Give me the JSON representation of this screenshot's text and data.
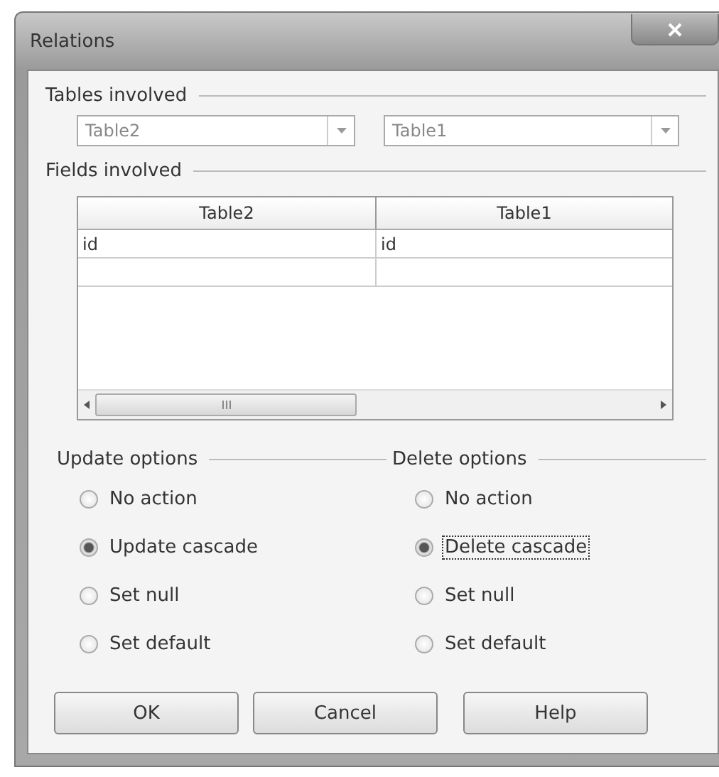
{
  "window": {
    "title": "Relations"
  },
  "tables_involved": {
    "label": "Tables involved",
    "combos": [
      {
        "value": "Table2"
      },
      {
        "value": "Table1"
      }
    ]
  },
  "fields_involved": {
    "label": "Fields involved",
    "columns": [
      "Table2",
      "Table1"
    ],
    "rows": [
      [
        "id",
        "id"
      ],
      [
        "",
        ""
      ]
    ]
  },
  "option_groups": [
    {
      "label": "Update options",
      "options": [
        {
          "label": "No action",
          "selected": false,
          "focused": false
        },
        {
          "label": "Update cascade",
          "selected": true,
          "focused": false
        },
        {
          "label": "Set null",
          "selected": false,
          "focused": false
        },
        {
          "label": "Set default",
          "selected": false,
          "focused": false
        }
      ]
    },
    {
      "label": "Delete options",
      "options": [
        {
          "label": "No action",
          "selected": false,
          "focused": false
        },
        {
          "label": "Delete cascade",
          "selected": true,
          "focused": true
        },
        {
          "label": "Set null",
          "selected": false,
          "focused": false
        },
        {
          "label": "Set default",
          "selected": false,
          "focused": false
        }
      ]
    }
  ],
  "buttons": [
    "OK",
    "Cancel",
    "Help"
  ]
}
